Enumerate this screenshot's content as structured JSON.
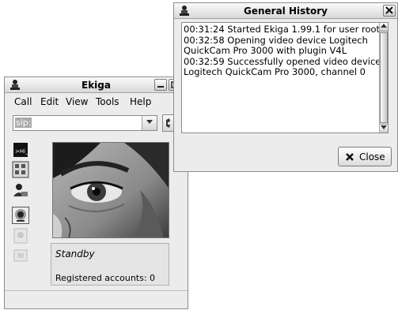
{
  "ekiga": {
    "title": "Ekiga",
    "menu": [
      {
        "label": "Call"
      },
      {
        "label": "Edit"
      },
      {
        "label": "View"
      },
      {
        "label": "Tools"
      },
      {
        "label": "Help"
      }
    ],
    "address_value": "sip:",
    "status": "Standby",
    "accounts": "Registered accounts: 0",
    "sidebar_icons": [
      "text-chat-icon",
      "dialpad-icon",
      "contacts-icon",
      "webcam-icon",
      "audio-settings-icon",
      "video-settings-icon"
    ]
  },
  "history": {
    "title": "General History",
    "text": "00:31:24 Started Ekiga 1.99.1 for user root\n00:32:58 Opening video device Logitech\nQuickCam Pro 3000 with plugin V4L\n00:32:59 Successfully opened video device\nLogitech QuickCam Pro 3000, channel 0",
    "close_label": "Close"
  }
}
